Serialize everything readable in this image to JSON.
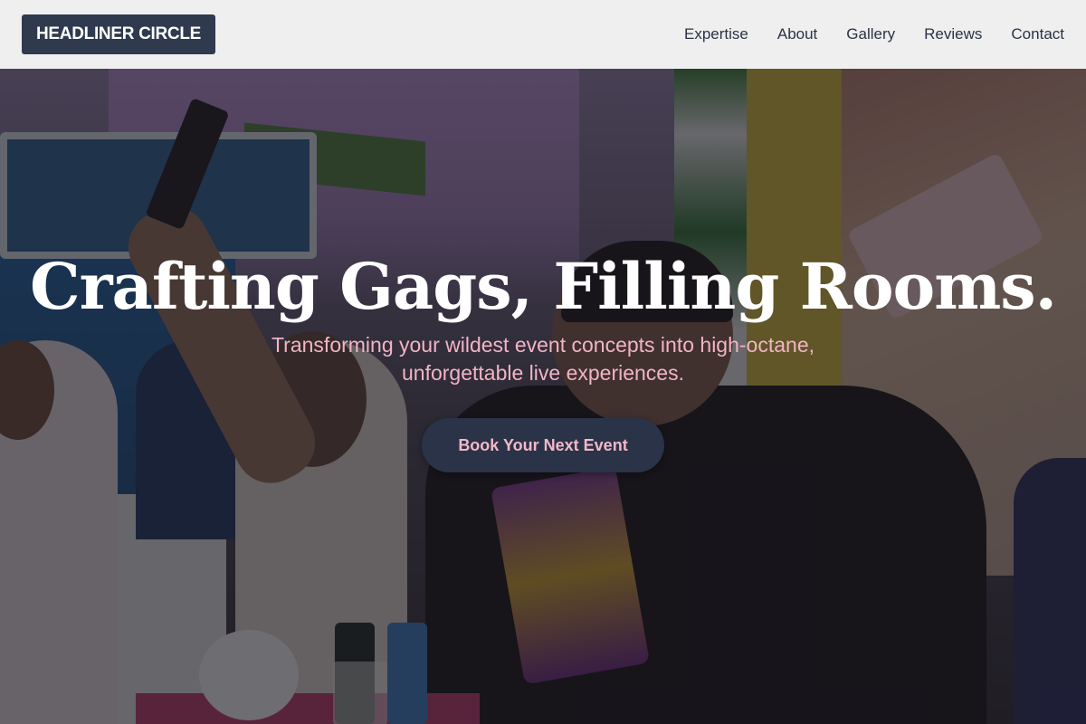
{
  "header": {
    "logo": "HEADLINER CIRCLE",
    "nav": [
      "Expertise",
      "About",
      "Gallery",
      "Reviews",
      "Contact"
    ]
  },
  "hero": {
    "headline": "Crafting Gags, Filling Rooms.",
    "subheadline": "Transforming your wildest event concepts into high-octane, unforgettable live experiences.",
    "cta_label": "Book Your Next Event",
    "background_image": "event-crowd-photo"
  },
  "colors": {
    "header_bg": "#efefef",
    "logo_bg": "#2f3a4e",
    "nav_text": "#2c3345",
    "headline_text": "#ffffff",
    "subheadline_text": "#f2b4c4",
    "cta_bg": "#2a3348",
    "cta_text": "#f4b8c8"
  }
}
